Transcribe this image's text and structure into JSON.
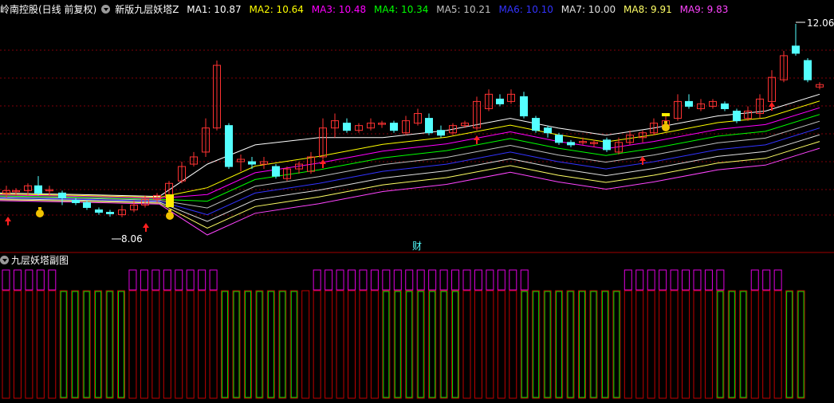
{
  "header": {
    "stock_title": "岭南控股(日线 前复权)",
    "indicator_name": "新版九层妖塔Z",
    "ma_items": [
      {
        "label": "MA1: 10.87",
        "color": "#ffffff"
      },
      {
        "label": "MA2: 10.64",
        "color": "#ffff00"
      },
      {
        "label": "MA3: 10.48",
        "color": "#ff00ff"
      },
      {
        "label": "MA4: 10.34",
        "color": "#00ff00"
      },
      {
        "label": "MA5: 10.21",
        "color": "#c0c0c0"
      },
      {
        "label": "MA6: 10.10",
        "color": "#3333ff"
      },
      {
        "label": "MA7: 10.00",
        "color": "#e0e0e0"
      },
      {
        "label": "MA8: 9.91",
        "color": "#ffff66"
      },
      {
        "label": "MA9: 9.83",
        "color": "#ff44ff"
      }
    ]
  },
  "main_chart": {
    "high_label": "12.06",
    "low_label": "8.06",
    "cai_marker": "财",
    "colors": {
      "up": "#ff3232",
      "down": "#54ffff",
      "grid": "#80000a",
      "arrow": "#ff2020",
      "coin": "#f2c200"
    }
  },
  "sub_chart": {
    "title": "九层妖塔副图",
    "colors": {
      "purple": "#e000e0",
      "red": "#c00000",
      "green": "#00e000"
    }
  }
}
